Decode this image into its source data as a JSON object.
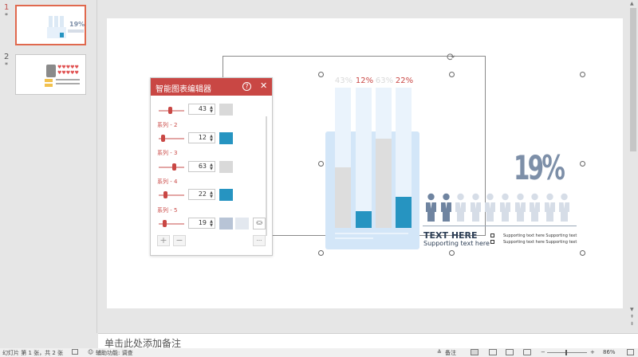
{
  "thumbnails": [
    {
      "number": "1",
      "star": "*",
      "selected": true,
      "mini_pct": "19%"
    },
    {
      "number": "2",
      "star": "*",
      "selected": false
    }
  ],
  "notes": {
    "placeholder": "单击此处添加备注"
  },
  "statusbar": {
    "slide_info": "幻灯片 第 1 张，共 2 张",
    "accessibility": "辅助功能: 调查",
    "notes_btn": "备注",
    "zoom": "86%"
  },
  "infographic": {
    "percent_labels": [
      {
        "text": "43%",
        "color": "#d9d9d9"
      },
      {
        "text": "12%",
        "color": "#c94744"
      },
      {
        "text": "63%",
        "color": "#d9d9d9"
      },
      {
        "text": "22%",
        "color": "#c94744"
      }
    ],
    "tube_values": [
      0.43,
      0.12,
      0.63,
      0.22
    ],
    "tube_colors": [
      "#dddddd",
      "#2694c1",
      "#dddddd",
      "#2694c1"
    ],
    "big_percent": "19%",
    "people_highlighted": 2,
    "people_total": 10,
    "title": "TEXT HERE",
    "subtitle": "Supporting text here",
    "supporting_lines": [
      "Supporting text here Supporting text",
      "Supporting text here Supporting text"
    ]
  },
  "editor": {
    "title": "智能图表编辑器",
    "help_icon": "?",
    "close_icon": "✕",
    "rows": [
      {
        "label": "",
        "value": "43",
        "color": "#d9d9d9",
        "slider": 0.43
      },
      {
        "label": "系列 - 2",
        "value": "12",
        "color": "#2694c1",
        "slider": 0.12
      },
      {
        "label": "系列 - 3",
        "value": "63",
        "color": "#d9d9d9",
        "slider": 0.63
      },
      {
        "label": "系列 - 4",
        "value": "22",
        "color": "#2694c1",
        "slider": 0.22
      },
      {
        "label": "系列 - 5",
        "value": "19",
        "color": "#b8c4d6",
        "slider": 0.19
      }
    ],
    "add_label": "+",
    "remove_label": "−",
    "more_label": "···"
  },
  "colors": {
    "accent": "#c94744",
    "blue": "#2694c1",
    "people_dark": "#6f84a0",
    "people_light": "#d6dde7"
  }
}
